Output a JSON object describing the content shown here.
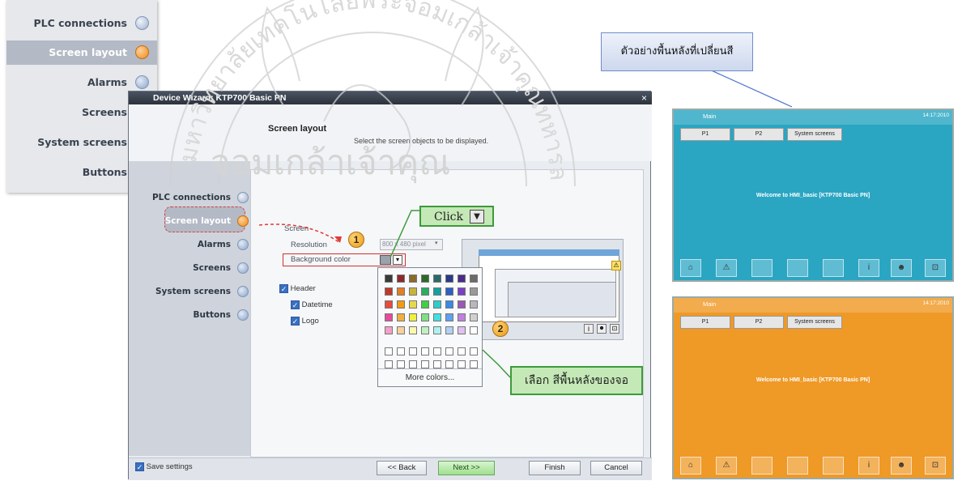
{
  "nav_panel": {
    "items": [
      {
        "label": "PLC connections",
        "state": "done"
      },
      {
        "label": "Screen layout",
        "state": "active"
      },
      {
        "label": "Alarms",
        "state": "pending"
      },
      {
        "label": "Screens",
        "state": "pending"
      },
      {
        "label": "System screens",
        "state": "pending"
      },
      {
        "label": "Buttons",
        "state": "pending"
      }
    ]
  },
  "wizard": {
    "title": "Device Wizard: KTP700 Basic PN",
    "close_glyph": "×",
    "heading": "Screen layout",
    "subheading": "Select the screen objects to be displayed.",
    "nav": [
      {
        "label": "PLC connections",
        "state": "done"
      },
      {
        "label": "Screen layout",
        "state": "active"
      },
      {
        "label": "Alarms",
        "state": "pending"
      },
      {
        "label": "Screens",
        "state": "pending"
      },
      {
        "label": "System screens",
        "state": "pending"
      },
      {
        "label": "Buttons",
        "state": "pending"
      }
    ],
    "screen_group": "Screen",
    "resolution_label": "Resolution",
    "resolution_value": "800 x 480 pixel",
    "background_label": "Background color",
    "header_label": "Header",
    "datetime_label": "Datetime",
    "logo_label": "Logo",
    "more_colors": "More colors...",
    "save_settings": "Save settings",
    "buttons": {
      "back": "<< Back",
      "next": "Next >>",
      "finish": "Finish",
      "cancel": "Cancel"
    }
  },
  "callouts": {
    "click": "Click",
    "step1": "1",
    "step2": "2",
    "select_bg": "เลือก สีพื้นหลังของจอ",
    "example_bg": "ตัวอย่างพื้นหลังที่เปลี่ยนสี"
  },
  "watermark": {
    "arc_text": "มหาวิทยาลัยเทคโนโลยีพระจอมเกล้าเจ้าคุณทหารลาดกระบัง",
    "line": "จอมเกล้าเจ้าคุณ"
  },
  "hmi_examples": [
    {
      "bar_label": "Main",
      "time": "14:17:2010",
      "tabs": [
        "P1",
        "P2",
        "System screens"
      ],
      "message": "Welcome to HMI_basic [KTP700 Basic PN]",
      "color": "#2aa6c3"
    },
    {
      "bar_label": "Main",
      "time": "14:17:2010",
      "tabs": [
        "P1",
        "P2",
        "System screens"
      ],
      "message": "Welcome to HMI_basic [KTP700 Basic PN]",
      "color": "#ef9926"
    }
  ],
  "hmi_icons": [
    "home-icon",
    "warning-icon",
    "info-icon",
    "user-icon",
    "exit-icon"
  ],
  "palette_colors": [
    [
      "#3a3a3a",
      "#8a2b2b",
      "#8a6a2b",
      "#2b6a2b",
      "#2b6a6a",
      "#2b3a8a",
      "#4a2b8a",
      "#6a6a6a"
    ],
    [
      "#c0392b",
      "#e67e22",
      "#c7b43a",
      "#27ae60",
      "#16a0a0",
      "#2e5fc7",
      "#7b3fc7",
      "#9a9a9a"
    ],
    [
      "#e74c3c",
      "#f39c12",
      "#e6d84a",
      "#40d040",
      "#2ecccc",
      "#3a8ae6",
      "#9b59b6",
      "#b8b8b8"
    ],
    [
      "#e84a9a",
      "#f0b040",
      "#f0f040",
      "#80e080",
      "#40e0e0",
      "#60a0f0",
      "#c080e0",
      "#d0d0d0"
    ],
    [
      "#f4a0c8",
      "#f8d0a0",
      "#f8f8b0",
      "#c0f0c0",
      "#b0f0f0",
      "#b0d0f8",
      "#e0c0f0",
      "#ffffff"
    ],
    [
      "#ffffff",
      "#ffffff",
      "#ffffff",
      "#ffffff",
      "#ffffff",
      "#ffffff",
      "#ffffff",
      "#ffffff"
    ],
    [
      "#ffffff",
      "#ffffff",
      "#ffffff",
      "#ffffff",
      "#ffffff",
      "#ffffff",
      "#ffffff",
      "#ffffff"
    ]
  ]
}
